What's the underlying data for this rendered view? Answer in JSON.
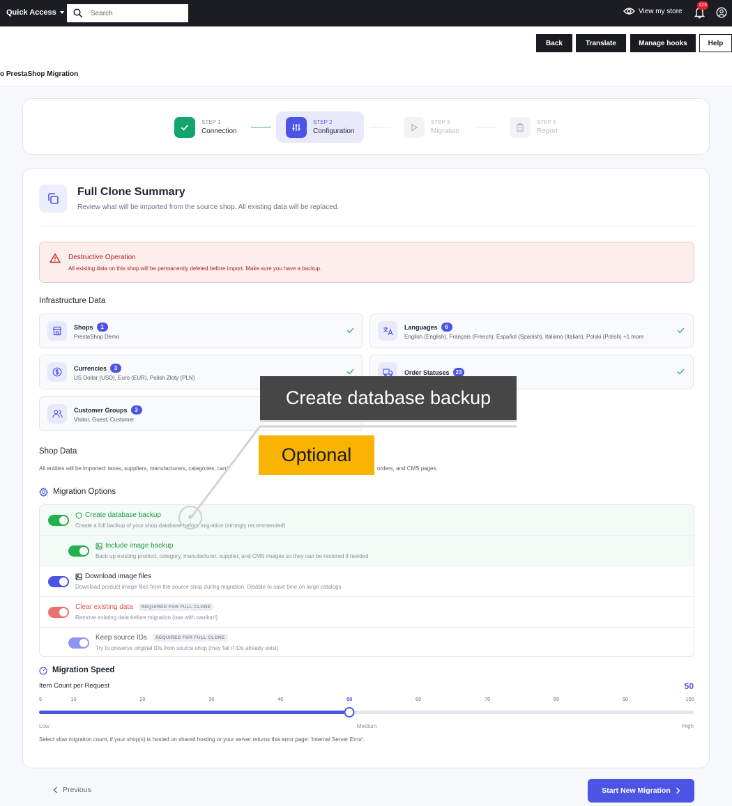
{
  "topbar": {
    "quick_access": "Quick Access",
    "search_placeholder": "Search",
    "view_store": "View my store",
    "notif_count": "123"
  },
  "header": {
    "back": "Back",
    "translate": "Translate",
    "manage_hooks": "Manage hooks",
    "help": "Help",
    "page_title": "o PrestaShop Migration"
  },
  "stepper": {
    "steps": [
      {
        "num": "STEP 1",
        "label": "Connection"
      },
      {
        "num": "STEP 2",
        "label": "Configuration"
      },
      {
        "num": "STEP 3",
        "label": "Migration"
      },
      {
        "num": "STEP 4",
        "label": "Report"
      }
    ]
  },
  "summary": {
    "title": "Full Clone Summary",
    "subtitle": "Review what will be imported from the source shop. All existing data will be replaced."
  },
  "alert": {
    "title": "Destructive Operation",
    "desc": "All existing data on this shop will be permanently deleted before import. Make sure you have a backup."
  },
  "infrastructure": {
    "heading": "Infrastructure Data",
    "items": [
      {
        "name": "Shops",
        "count": "1",
        "desc": "PrestaShop Demo"
      },
      {
        "name": "Languages",
        "count": "6",
        "desc": "English (English), Français (French), Español (Spanish), Italiano (Italian), Polski (Polish) +1 more"
      },
      {
        "name": "Currencies",
        "count": "3",
        "desc": "US Dollar (USD), Euro (EUR), Polish Zloty (PLN)"
      },
      {
        "name": "Order Statuses",
        "count": "23",
        "desc": ""
      },
      {
        "name": "Customer Groups",
        "count": "3",
        "desc": "Visitor, Guest, Customer"
      }
    ]
  },
  "shop_data": {
    "heading": "Shop Data",
    "desc_start": "All entities will be imported: taxes, suppliers, manufacturers, categories, carri",
    "desc_end": "orders, and CMS pages."
  },
  "migration_options": {
    "heading": "Migration Options",
    "items": [
      {
        "title": "Create database backup",
        "desc": "Create a full backup of your shop database before migration (strongly recommended)",
        "enabled": true,
        "color": "#22b14c"
      },
      {
        "title": "Include image backup",
        "desc": "Back up existing product, category, manufacturer, supplier, and CMS images so they can be restored if needed",
        "enabled": true,
        "color": "#22b14c"
      },
      {
        "title": "Download image files",
        "desc": "Download product image files from the source shop during migration. Disable to save time on large catalogs.",
        "enabled": true,
        "color": "#4c54e6"
      },
      {
        "title": "Clear existing data",
        "badge": "REQUIRED FOR FULL CLONE",
        "desc": "Remove existing data before migration (use with caution!)",
        "enabled": true,
        "color": "#e8726e"
      },
      {
        "title": "Keep source IDs",
        "badge": "REQUIRED FOR FULL CLONE",
        "desc": "Try to preserve original IDs from source shop (may fail if IDs already exist)",
        "enabled": true,
        "color": "#8f94ee"
      }
    ]
  },
  "migration_speed": {
    "heading": "Migration Speed",
    "label": "Item Count per Request",
    "value": 50,
    "min": 5,
    "max": 100,
    "ticks": [
      "5",
      "10",
      "20",
      "30",
      "40",
      "50",
      "60",
      "70",
      "80",
      "90",
      "100"
    ],
    "low": "Low",
    "medium": "Medium",
    "high": "High",
    "desc": "Select slow migration count, if your shop(s) is hosted on shared hosting or your server returns this error page: 'Internal Server Error'."
  },
  "footer": {
    "previous": "Previous",
    "start": "Start New Migration"
  },
  "overlay": {
    "callout": "Create database backup",
    "optional": "Optional"
  },
  "colors": {
    "accent": "#4c54e6",
    "success": "#12a56c",
    "danger": "#b01e1e"
  }
}
